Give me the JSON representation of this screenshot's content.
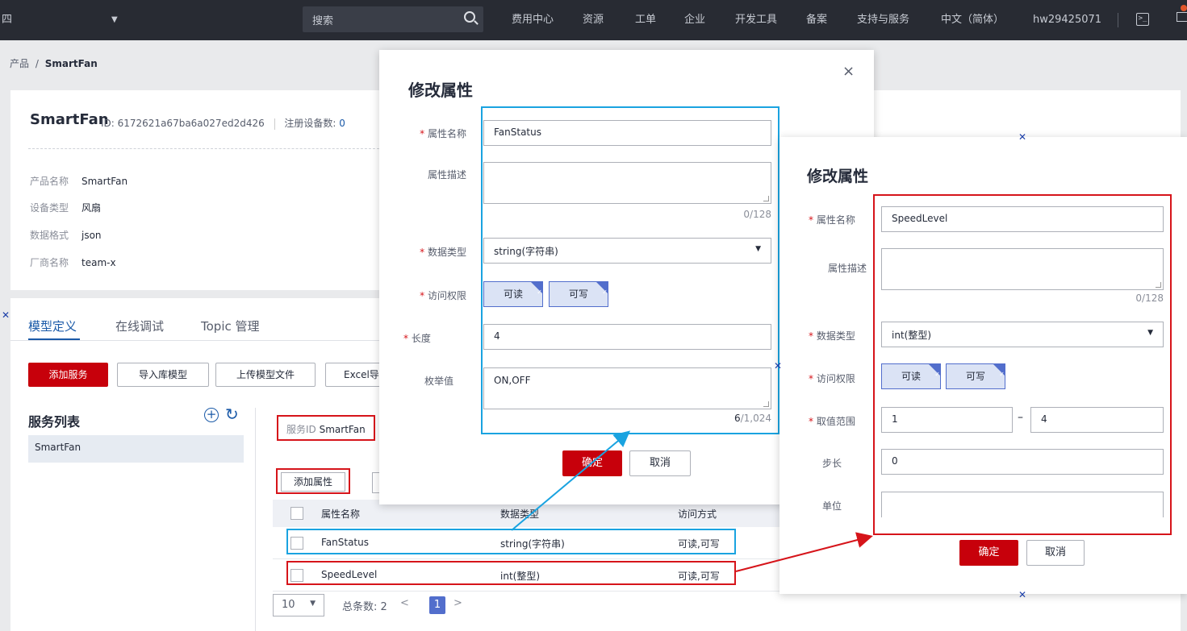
{
  "topbar": {
    "region": "四",
    "search_placeholder": "搜索",
    "nav": [
      "费用中心",
      "资源",
      "工单",
      "企业",
      "开发工具",
      "备案",
      "支持与服务",
      "中文（简体）",
      "hw29425071"
    ]
  },
  "breadcrumb": {
    "root": "产品",
    "sep": "/",
    "current": "SmartFan"
  },
  "product": {
    "name": "SmartFan",
    "id_label": "ID: 6172621a67ba6a027ed2d426",
    "devices_label": "注册设备数:",
    "devices_count": "0",
    "fields": [
      {
        "key": "产品名称",
        "value": "SmartFan"
      },
      {
        "key": "设备类型",
        "value": "风扇"
      },
      {
        "key": "数据格式",
        "value": "json"
      },
      {
        "key": "厂商名称",
        "value": "team-x"
      }
    ]
  },
  "tabs": [
    "模型定义",
    "在线调试",
    "Topic 管理"
  ],
  "toolbar": [
    "添加服务",
    "导入库模型",
    "上传模型文件",
    "Excel导"
  ],
  "service_list": {
    "title": "服务列表",
    "items": [
      "SmartFan"
    ]
  },
  "service_id": {
    "label": "服务ID",
    "value": "SmartFan"
  },
  "add_property_label": "添加属性",
  "table": {
    "headers": [
      "属性名称",
      "数据类型",
      "访问方式"
    ],
    "rows": [
      {
        "name": "FanStatus",
        "type": "string(字符串)",
        "access": "可读,可写"
      },
      {
        "name": "SpeedLevel",
        "type": "int(整型)",
        "access": "可读,可写"
      }
    ]
  },
  "pager": {
    "size": "10",
    "total": "总条数:  2",
    "prev": "<",
    "page": "1",
    "next": ">"
  },
  "modal1": {
    "title": "修改属性",
    "close": "×",
    "labels": {
      "name": "属性名称",
      "desc": "属性描述",
      "type": "数据类型",
      "access": "访问权限",
      "length": "长度",
      "enum": "枚举值"
    },
    "required_mark": "*",
    "name_value": "FanStatus",
    "desc_counter": "0/128",
    "type_value": "string(字符串)",
    "access": [
      "可读",
      "可写"
    ],
    "length_value": "4",
    "enum_value": "ON,OFF",
    "enum_count": "6",
    "enum_max": "/1,024",
    "ok": "确定",
    "cancel": "取消"
  },
  "modal2": {
    "title": "修改属性",
    "labels": {
      "name": "属性名称",
      "desc": "属性描述",
      "type": "数据类型",
      "access": "访问权限",
      "range": "取值范围",
      "step": "步长",
      "unit": "单位"
    },
    "required_mark": "*",
    "name_value": "SpeedLevel",
    "desc_counter": "0/128",
    "type_value": "int(整型)",
    "access": [
      "可读",
      "可写"
    ],
    "range_min": "1",
    "range_dash": "–",
    "range_max": "4",
    "step_value": "0",
    "unit_value": "",
    "ok": "确定",
    "cancel": "取消"
  },
  "colors": {
    "brand_red": "#c7000b",
    "link_blue": "#1b5aa8",
    "highlight_blue": "#1aa3e0",
    "highlight_red": "#d6141a",
    "topbar": "#282b33"
  }
}
